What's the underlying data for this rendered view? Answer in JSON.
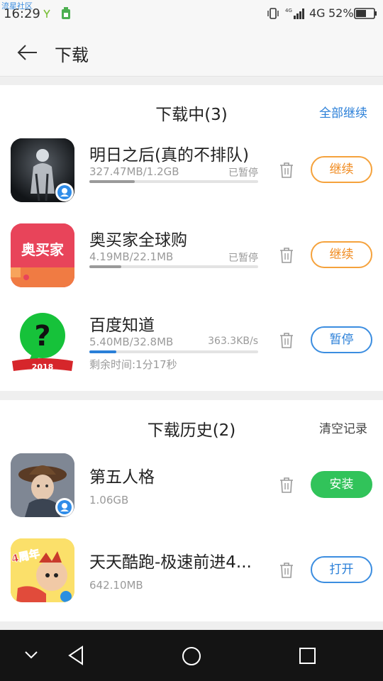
{
  "statusbar": {
    "watermark": "流星社区",
    "time": "16:29",
    "network": "4G",
    "battery": "52%"
  },
  "appbar": {
    "title": "下载"
  },
  "downloading": {
    "title": "下载中(3)",
    "action": "全部继续",
    "items": [
      {
        "name": "明日之后(真的不排队)",
        "size": "327.47MB/1.2GB",
        "state": "已暂停",
        "progress": 0.27,
        "button": "继续"
      },
      {
        "name": "奥买家全球购",
        "size": "4.19MB/22.1MB",
        "state": "已暂停",
        "progress": 0.19,
        "button": "继续",
        "icon_text": "奥买家"
      },
      {
        "name": "百度知道",
        "size": "5.40MB/32.8MB",
        "state": "363.3KB/s",
        "progress": 0.16,
        "button": "暂停",
        "remaining": "剩余时间:1分17秒",
        "icon_text": "2018",
        "icon_glyph": "?"
      }
    ]
  },
  "history": {
    "title": "下载历史(2)",
    "action": "清空记录",
    "items": [
      {
        "name": "第五人格",
        "size": "1.06GB",
        "button": "安装"
      },
      {
        "name": "天天酷跑-极速前进4...",
        "size": "642.10MB",
        "button": "打开",
        "icon_text": "4周年"
      }
    ]
  },
  "colors": {
    "accent_blue": "#2a7fd8",
    "accent_orange": "#f08a1e",
    "accent_green": "#31c35a",
    "aomaijia_red": "#e8445a",
    "baidu_green": "#16c23a"
  },
  "icons": [
    "back-arrow-icon",
    "trash-icon",
    "vibrate-icon",
    "battery-icon",
    "signal-icon",
    "wechat-badge-icon"
  ]
}
